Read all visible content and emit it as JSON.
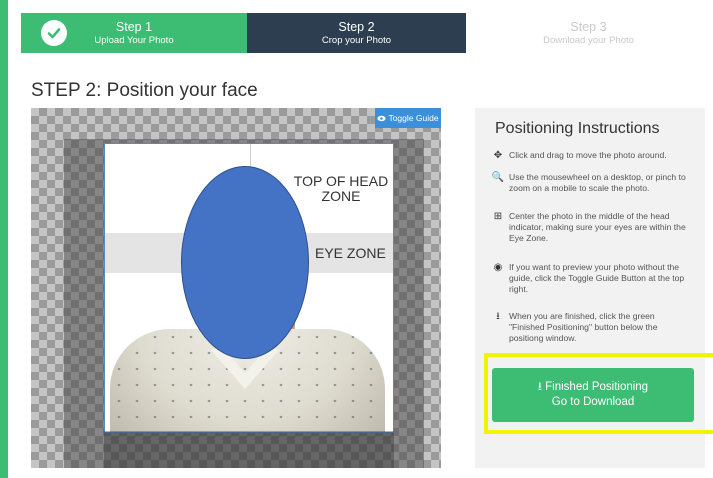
{
  "steps": [
    {
      "title": "Step 1",
      "subtitle": "Upload Your Photo"
    },
    {
      "title": "Step 2",
      "subtitle": "Crop your Photo"
    },
    {
      "title": "Step 3",
      "subtitle": "Download your Photo"
    }
  ],
  "page_title": "STEP 2: Position your face",
  "crop": {
    "toggle_guide_label": "Toggle Guide",
    "head_zone_label": "TOP OF HEAD ZONE",
    "eye_zone_label": "EYE ZONE"
  },
  "instructions": {
    "title": "Positioning Instructions",
    "items": [
      {
        "icon": "move-icon",
        "text": "Click and drag to move the photo around."
      },
      {
        "icon": "zoom-icon",
        "text": "Use the mousewheel on a desktop, or pinch to zoom on a mobile to scale the photo."
      },
      {
        "icon": "plus-square-icon",
        "text": "Center the photo in the middle of the head indicator, making sure your eyes are within the Eye Zone."
      },
      {
        "icon": "eye-slash-icon",
        "text": "If you want to preview your photo without the guide, click the Toggle Guide Button at the top right."
      },
      {
        "icon": "download-icon",
        "text": "When you are finished, click the green \"Finished Positioning\" button below the positiong window."
      }
    ]
  },
  "finish_button": {
    "line1": "Finished Positioning",
    "line2": "Go to Download"
  },
  "colors": {
    "green": "#3dbd74",
    "dark": "#2c3e50",
    "blue": "#3b90d9",
    "highlight": "#f3f300",
    "face_mask": "#4472c4"
  }
}
